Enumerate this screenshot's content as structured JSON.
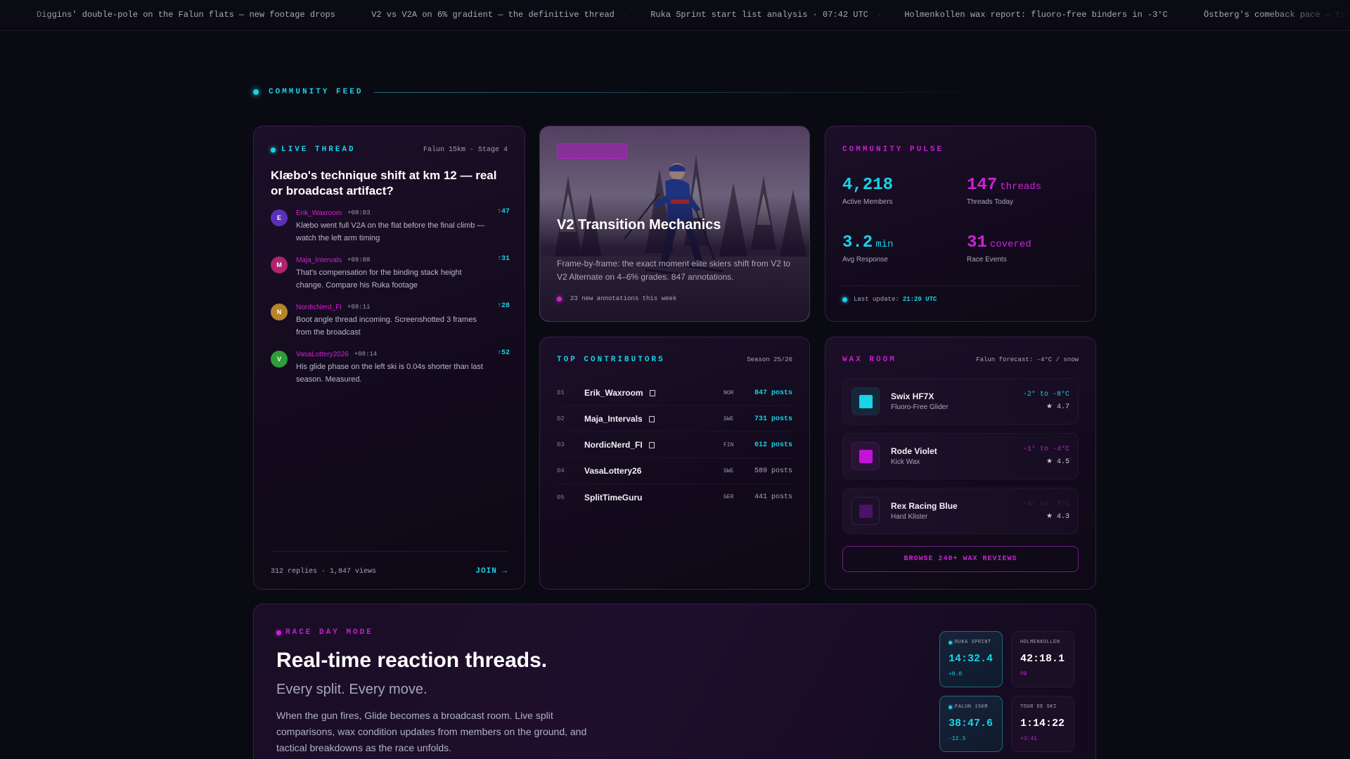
{
  "ticker": {
    "items": [
      "Diggins' double-pole on the Falun flats — new footage drops",
      "V2 vs V2A on 6% gradient — the definitive thread",
      "Ruka Sprint start list analysis · 07:42 UTC",
      "Holmenkollen wax report: fluoro-free binders in -3°C",
      "Östberg's comeback pace — training blo"
    ],
    "separator": "·"
  },
  "section": {
    "title": "COMMUNITY FEED"
  },
  "live_thread": {
    "label": "LIVE THREAD",
    "meta": "Falun 15km · Stage 4",
    "title": "Klæbo's technique shift at km 12 — real or broadcast artifact?",
    "comments": [
      {
        "initial": "E",
        "user": "Erik_Waxroom",
        "time": "+08:03",
        "votes": "↑47",
        "color": "#5b2fb8",
        "text": "Klæbo went full V2A on the flat before the final climb — watch the left arm timing"
      },
      {
        "initial": "M",
        "user": "Maja_Intervals",
        "time": "+08:08",
        "votes": "↑31",
        "color": "#b0236f",
        "text": "That's compensation for the binding stack height change. Compare his Ruka footage"
      },
      {
        "initial": "N",
        "user": "NordicNerd_FI",
        "time": "+08:11",
        "votes": "↑28",
        "color": "#b5852a",
        "text": "Boot angle thread incoming. Screenshotted 3 frames from the broadcast"
      },
      {
        "initial": "V",
        "user": "VasaLottery2026",
        "time": "+08:14",
        "votes": "↑52",
        "color": "#2d9d3a",
        "text": "His glide phase on the left ski is 0.04s shorter than last season. Measured."
      }
    ],
    "stats": "312 replies · 1,847 views",
    "join": "JOIN →"
  },
  "featured": {
    "title": "V2 Transition Mechanics",
    "description": "Frame-by-frame: the exact moment elite skiers shift from V2 to V2 Alternate on 4–6% grades. 847 annotations.",
    "footer": "23 new annotations this week"
  },
  "pulse": {
    "label": "COMMUNITY PULSE",
    "stats": [
      {
        "value": "4,218",
        "unit": "",
        "label": "Active Members",
        "accent": "cyan"
      },
      {
        "value": "147",
        "unit": "threads",
        "label": "Threads Today",
        "accent": "mag"
      },
      {
        "value": "3.2",
        "unit": "min",
        "label": "Avg Response",
        "accent": "cyan"
      },
      {
        "value": "31",
        "unit": "covered",
        "label": "Race Events",
        "accent": "mag"
      }
    ],
    "update_label": "Last update:",
    "update_time": "21:20 UTC"
  },
  "contributors": {
    "label": "TOP CONTRIBUTORS",
    "season": "Season 25/26",
    "rows": [
      {
        "rank": "01",
        "name": "Erik_Waxroom",
        "verified": true,
        "country": "NOR",
        "posts": "847 posts",
        "hot": true
      },
      {
        "rank": "02",
        "name": "Maja_Intervals",
        "verified": true,
        "country": "SWE",
        "posts": "731 posts",
        "hot": true
      },
      {
        "rank": "03",
        "name": "NordicNerd_FI",
        "verified": true,
        "country": "FIN",
        "posts": "612 posts",
        "hot": true
      },
      {
        "rank": "04",
        "name": "VasaLottery26",
        "verified": false,
        "country": "SWE",
        "posts": "589 posts",
        "hot": false
      },
      {
        "rank": "05",
        "name": "SplitTimeGuru",
        "verified": false,
        "country": "GER",
        "posts": "441 posts",
        "hot": false
      }
    ]
  },
  "wax": {
    "label": "WAX ROOM",
    "forecast": "Falun forecast: -4°C / snow",
    "items": [
      {
        "name": "Swix HF7X",
        "type": "Fluoro-Free Glider",
        "temp": "-2° to -8°C",
        "rating": "★ 4.7",
        "swatch": "#19d3e6",
        "wrap": "#14283a",
        "temp_color": "#19d3e6"
      },
      {
        "name": "Rode Violet",
        "type": "Kick Wax",
        "temp": "-1° to -4°C",
        "rating": "★ 4.5",
        "swatch": "#c213d6",
        "wrap": "#2c1238",
        "temp_color": "#c41ed0"
      },
      {
        "name": "Rex Racing Blue",
        "type": "Hard Klister",
        "temp": "-4° to -9°C",
        "rating": "★ 4.3",
        "swatch": "#4a1366",
        "wrap": "#1c0f28",
        "temp_color": "#3d1a4d"
      }
    ],
    "browse": "BROWSE 240+ WAX REVIEWS"
  },
  "raceday": {
    "label": "RACE DAY MODE",
    "title": "Real-time reaction threads.",
    "subtitle": "Every split. Every move.",
    "description": "When the gun fires, Glide becomes a broadcast room. Live split comparisons, wax condition updates from members on the ground, and tactical breakdowns as the race unfolds.",
    "splits": [
      {
        "event": "RUKA SPRINT",
        "time": "14:32.4",
        "delta": "+0.0",
        "live": true
      },
      {
        "event": "HOLMENKOLLEN",
        "time": "42:18.1",
        "delta": "PB",
        "live": false
      },
      {
        "event": "FALUN 15KM",
        "time": "38:47.6",
        "delta": "-12.3",
        "live": true
      },
      {
        "event": "TOUR DE SKI",
        "time": "1:14:22",
        "delta": "+3:41",
        "live": false
      }
    ]
  },
  "colors": {
    "cyan": "#19d3e6",
    "magenta": "#d020dc",
    "background": "#0a0b12"
  }
}
